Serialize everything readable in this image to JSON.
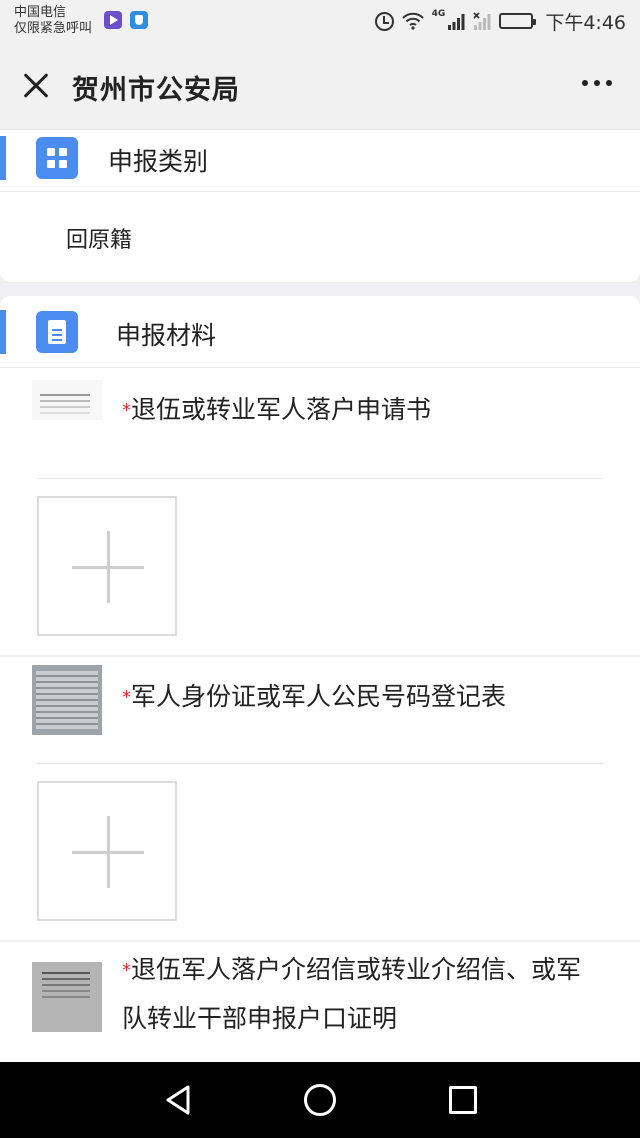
{
  "status_bar": {
    "carrier_line1": "中国电信",
    "carrier_line2": "仅限紧急呼叫",
    "network": "4G",
    "time": "下午4:46"
  },
  "titlebar": {
    "title": "贺州市公安局",
    "icons": [
      "close-icon",
      "more-icon"
    ]
  },
  "category": {
    "header": "申报类别",
    "value": "回原籍",
    "icon": "grid-icon"
  },
  "materials": {
    "header": "申报材料",
    "icon": "document-icon",
    "required_mark": "*",
    "items": [
      {
        "label": "退伍或转业军人落户申请书"
      },
      {
        "label": "军人身份证或军人公民号码登记表"
      },
      {
        "label": "退伍军人落户介绍信或转业介绍信、或军队转业干部申报户口证明"
      }
    ]
  },
  "colors": {
    "accent": "#4a8cf0",
    "required": "#e02a2a",
    "background": "#efeff4"
  },
  "nav_icons": [
    "back-icon",
    "home-icon",
    "recent-apps-icon"
  ]
}
